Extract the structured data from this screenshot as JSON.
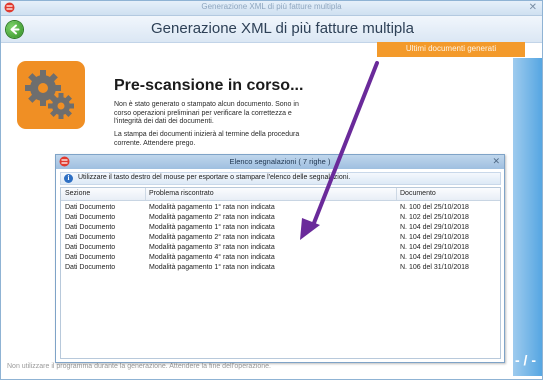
{
  "window": {
    "title": "Generazione XML di più fatture multipla"
  },
  "header": {
    "title": "Generazione XML di più fatture multipla"
  },
  "tabs": {
    "recent_docs": "Ultimi documenti generati"
  },
  "prescan": {
    "title": "Pre-scansione in corso...",
    "desc1": "Non è stato generato o stampato alcun documento. Sono in corso operazioni preliminari per verificare la correttezza e l'integrità dei dati dei documenti.",
    "desc2": "La stampa dei documenti inizierà al termine della procedura corrente. Attendere prego."
  },
  "dialog": {
    "title": "Elenco segnalazioni ( 7 righe )",
    "info": "Utilizzare il tasto destro del mouse per esportare o stampare l'elenco delle segnalazioni.",
    "columns": [
      "Sezione",
      "Problema riscontrato",
      "Documento"
    ],
    "rows": [
      [
        "Dati Documento",
        "Modalità pagamento 1° rata non indicata",
        "N. 100 del 25/10/2018"
      ],
      [
        "Dati Documento",
        "Modalità pagamento 2° rata non indicata",
        "N. 102 del 25/10/2018"
      ],
      [
        "Dati Documento",
        "Modalità pagamento 1° rata non indicata",
        "N. 104 del 29/10/2018"
      ],
      [
        "Dati Documento",
        "Modalità pagamento 2° rata non indicata",
        "N. 104 del 29/10/2018"
      ],
      [
        "Dati Documento",
        "Modalità pagamento 3° rata non indicata",
        "N. 104 del 29/10/2018"
      ],
      [
        "Dati Documento",
        "Modalità pagamento 4° rata non indicata",
        "N. 104 del 29/10/2018"
      ],
      [
        "Dati Documento",
        "Modalità pagamento 1° rata non indicata",
        "N. 106 del 31/10/2018"
      ]
    ]
  },
  "footer": {
    "note": "Non utilizzare il programma durante la generazione. Attendere la fine dell'operazione."
  },
  "side_mark": "- / -",
  "colors": {
    "orange": "#f39a2b",
    "arrow": "#6a2a9a",
    "accent_blue": "#56a6e2"
  }
}
